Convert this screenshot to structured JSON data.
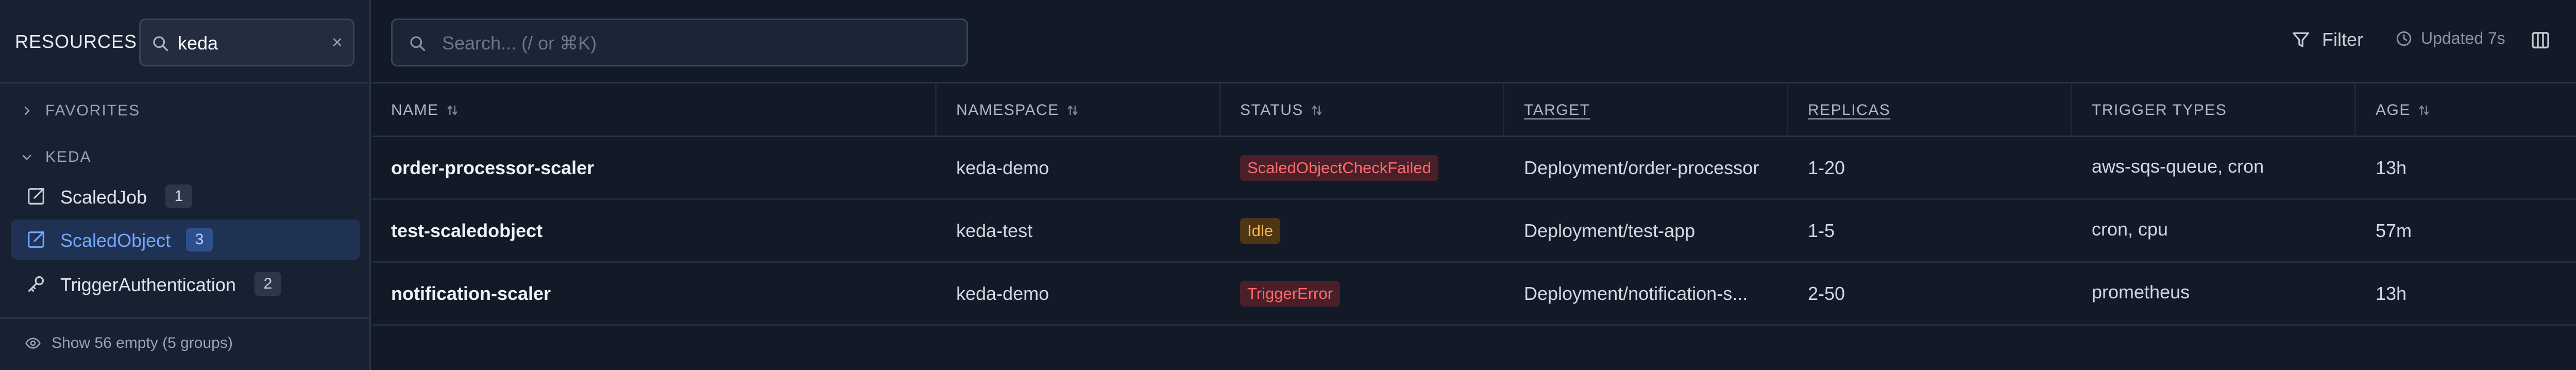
{
  "colors": {
    "accent": "#74a7ff",
    "status_failed_bg": "#4a1f29",
    "status_failed_fg": "#ff6b6b",
    "status_idle_bg": "#4d3614",
    "status_idle_fg": "#f3b44a"
  },
  "sidebar": {
    "title": "RESOURCES",
    "search": {
      "value": "keda",
      "clear_icon": "close-icon"
    },
    "favorites_label": "FAVORITES",
    "group_label": "KEDA",
    "items": [
      {
        "label": "ScaledJob",
        "count": "1",
        "icon": "scale-icon",
        "active": false
      },
      {
        "label": "ScaledObject",
        "count": "3",
        "icon": "scale-icon",
        "active": true
      },
      {
        "label": "TriggerAuthentication",
        "count": "2",
        "icon": "key-icon",
        "active": false
      }
    ],
    "footer": "Show 56 empty (5 groups)"
  },
  "topbar": {
    "search_placeholder": "Search... (/ or ⌘K)",
    "search_value": "",
    "filter_label": "Filter",
    "updated_label": "Updated 7s"
  },
  "table": {
    "columns": [
      {
        "label": "NAME",
        "sortable": true,
        "underlined": false
      },
      {
        "label": "NAMESPACE",
        "sortable": true,
        "underlined": false
      },
      {
        "label": "STATUS",
        "sortable": true,
        "underlined": false
      },
      {
        "label": "TARGET",
        "sortable": false,
        "underlined": true
      },
      {
        "label": "REPLICAS",
        "sortable": false,
        "underlined": true
      },
      {
        "label": "TRIGGER TYPES",
        "sortable": false,
        "underlined": false
      },
      {
        "label": "AGE",
        "sortable": true,
        "underlined": false
      }
    ],
    "rows": [
      {
        "name": "order-processor-scaler",
        "namespace": "keda-demo",
        "status": "ScaledObjectCheckFailed",
        "status_kind": "failed",
        "target": "Deployment/order-processor",
        "replicas": "1-20",
        "triggers": "aws-sqs-queue, cron",
        "age": "13h"
      },
      {
        "name": "test-scaledobject",
        "namespace": "keda-test",
        "status": "Idle",
        "status_kind": "idle",
        "target": "Deployment/test-app",
        "replicas": "1-5",
        "triggers": "cron, cpu",
        "age": "57m"
      },
      {
        "name": "notification-scaler",
        "namespace": "keda-demo",
        "status": "TriggerError",
        "status_kind": "failed",
        "target": "Deployment/notification-s...",
        "replicas": "2-50",
        "triggers": "prometheus",
        "age": "13h"
      }
    ]
  }
}
